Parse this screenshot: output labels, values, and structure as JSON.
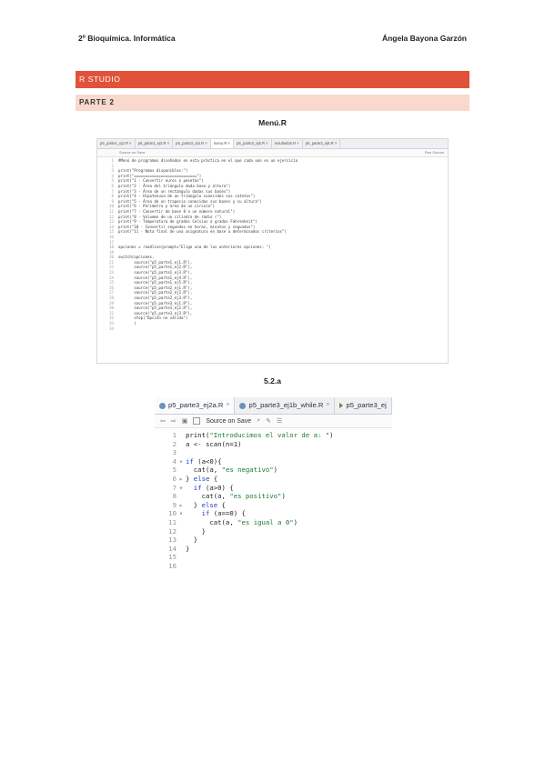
{
  "header": {
    "left": "2º Bioquímica. Informática",
    "right": "Ángela Bayona Garzón"
  },
  "section": {
    "title": "R STUDIO",
    "subtitle": "PARTE 2"
  },
  "figure1": {
    "caption": "Menú.R",
    "tabs": [
      "p5_parte1_ej2.R",
      "p5_parte3_ej3.R",
      "p5_parte3_ej4.R",
      "menu.R",
      "p5_parte3_ej5.R",
      "resultados.R",
      "p5_parte3_ej6.R"
    ],
    "toolbar_left": "Source on Save",
    "toolbar_right": "Run  Source",
    "lines": [
      "#Menú de programas diseñados en esta práctica en el que cada uno es un ejercicio",
      "",
      "print(\"Programas disponibles:\")",
      "print(\"============================\")",
      "print(\"1 - Convertir euros a pesetas\")",
      "print(\"2 - Área del triángulo dada base y altura\")",
      "print(\"3 - Área de un rectángulo dadas sus bases\")",
      "print(\"4 - Hipotenusa de un triángulo conocidos sus catetos\")",
      "print(\"5 - Área de un trapecio conocidas sus bases y su altura\")",
      "print(\"6 - Perímetro y área de un círculo\")",
      "print(\"7 - Convertir de base 8 a un número natural\")",
      "print(\"8 - Volumen de un cilindro de radio r\")",
      "print(\"9 - Temperatura de grados Celsius a grados Fahrenheit\")",
      "print(\"10 - Convertir segundos en horas, minutos y segundos\")",
      "print(\"11 - Nota final de una asignatura en base a determinados criterios\")",
      "",
      "",
      "opciones = readline(prompt=\"Elige una de las anteriores opciones: \")",
      "",
      "switch(opciones,",
      "       source(\"p5_parte1_ej1.R\"),",
      "       source(\"p5_parte1_ej2.R\"),",
      "       source(\"p5_parte1_ej3.R\"),",
      "       source(\"p5_parte1_ej4.R\"),",
      "       source(\"p5_parte1_ej5.R\"),",
      "       source(\"p5_parte2_ej1.R\"),",
      "       source(\"p5_parte2_ej2.R\"),",
      "       source(\"p5_parte2_ej3.R\"),",
      "       source(\"p5_parte3_ej1.R\"),",
      "       source(\"p5_parte3_ej2.R\"),",
      "       source(\"p5_parte3_ej3.R\"),",
      "       stop(\"Opción no válida\")",
      "       )",
      ""
    ]
  },
  "figure2": {
    "caption": "5.2.a",
    "tabs": [
      "p5_parte3_ej2a.R",
      "p5_parte3_ej1b_while.R",
      "p5_parte3_ej"
    ],
    "toolbar_label": "Source on Save",
    "lines": [
      "print(\"Introducimos el valor de a: \")",
      "a <- scan(n=1)",
      "",
      "if (a<0){",
      "  cat(a, \"es negativo\")",
      "} else {",
      "  if (a>0) {",
      "    cat(a, \"es positivo\")",
      "  } else {",
      "    if (a==0) {",
      "      cat(a, \"es igual a 0\")",
      "    }",
      "  }",
      "}",
      "",
      ""
    ],
    "fold_markers": [
      "",
      "",
      "",
      "▾",
      "",
      "▸",
      "▾",
      "",
      "▸",
      "▾",
      "",
      "",
      "",
      "",
      "",
      ""
    ]
  }
}
